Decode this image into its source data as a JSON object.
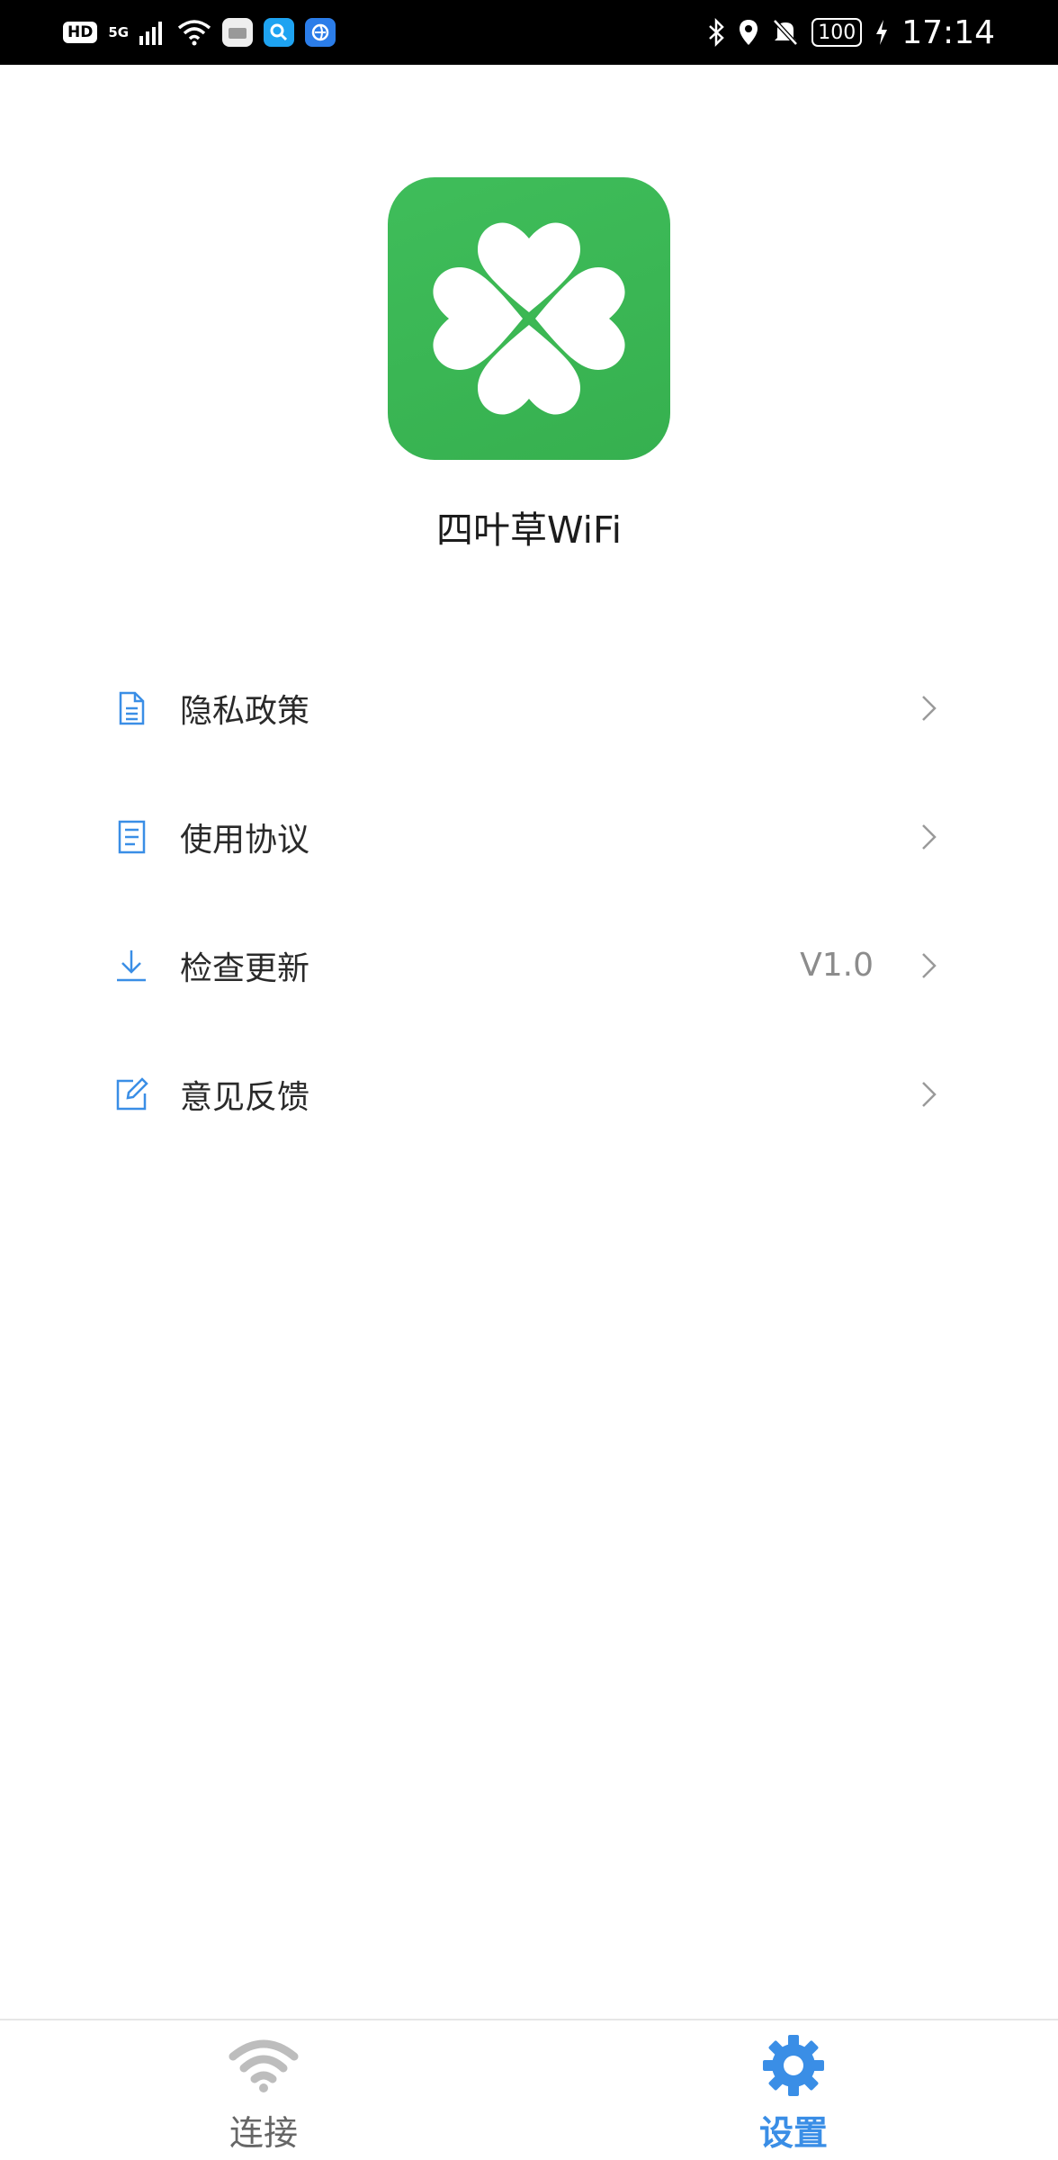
{
  "status_bar": {
    "hd_label": "HD",
    "network_label": "5G",
    "battery_level": "100",
    "time": "17:14",
    "icons": [
      "signal-icon",
      "wifi-icon",
      "huawei-icon",
      "search-app-icon",
      "browser-icon",
      "bluetooth-icon",
      "location-icon",
      "mute-icon",
      "charging-icon"
    ]
  },
  "app": {
    "name": "四叶草WiFi",
    "logo_icon": "clover-icon",
    "logo_color": "#3cb853"
  },
  "menu": {
    "items": [
      {
        "label": "隐私政策",
        "icon": "document-icon",
        "value": ""
      },
      {
        "label": "使用协议",
        "icon": "list-document-icon",
        "value": ""
      },
      {
        "label": "检查更新",
        "icon": "download-icon",
        "value": "V1.0"
      },
      {
        "label": "意见反馈",
        "icon": "edit-icon",
        "value": ""
      }
    ],
    "icon_color": "#3a8ee6"
  },
  "bottom_nav": {
    "tabs": [
      {
        "label": "连接",
        "icon": "wifi-icon",
        "active": false
      },
      {
        "label": "设置",
        "icon": "gear-icon",
        "active": true
      }
    ],
    "active_color": "#3a8ee6"
  }
}
